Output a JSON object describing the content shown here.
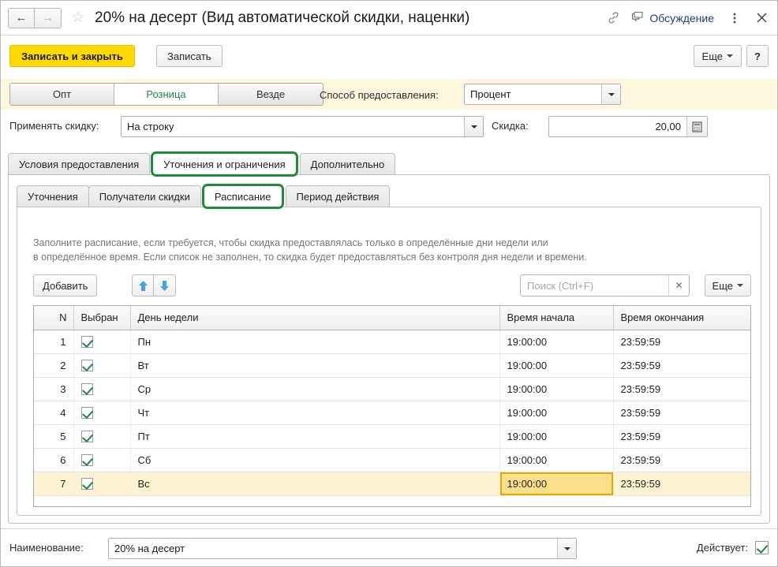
{
  "titlebar": {
    "back_icon": "arrow-left-icon",
    "forward_icon": "arrow-right-icon",
    "favorite_icon": "star-icon",
    "title": "20% на десерт (Вид автоматической скидки, наценки)",
    "link_icon": "link-icon",
    "discuss_icon": "chat-bubble-icon",
    "discuss_label": "Обсуждение",
    "menu_icon": "kebab-menu-icon",
    "close_icon": "close-icon"
  },
  "commandbar": {
    "save_and_close": "Записать и закрыть",
    "save": "Записать",
    "more": "Еще",
    "help": "?"
  },
  "segmented": {
    "items": [
      {
        "label": "Опт",
        "active": false
      },
      {
        "label": "Розница",
        "active": true
      },
      {
        "label": "Везде",
        "active": false
      }
    ]
  },
  "fields": {
    "sposob_label": "Способ предоставления:",
    "sposob_value": "Процент",
    "primenyat_label": "Применять скидку:",
    "primenyat_value": "На строку",
    "skidka_label": "Скидка:",
    "skidka_value": "20,00",
    "calc_icon": "calculator-icon"
  },
  "outer_tabs": [
    {
      "label": "Условия предоставления",
      "active": false,
      "marked": false
    },
    {
      "label": "Уточнения и ограничения",
      "active": true,
      "marked": true
    },
    {
      "label": "Дополнительно",
      "active": false,
      "marked": false
    }
  ],
  "inner_tabs": [
    {
      "label": "Уточнения",
      "active": false,
      "marked": false
    },
    {
      "label": "Получатели скидки",
      "active": false,
      "marked": false
    },
    {
      "label": "Расписание",
      "active": true,
      "marked": true
    },
    {
      "label": "Период действия",
      "active": false,
      "marked": false
    }
  ],
  "hint": {
    "line1": "Заполните расписание, если требуется, чтобы скидка предоставлялась только в определённые дни недели или",
    "line2": "в определённое время. Если список не заполнен, то скидка будет предоставляться без контроля дня недели и времени."
  },
  "list_toolbar": {
    "add": "Добавить",
    "move_up_icon": "arrow-up-icon",
    "move_down_icon": "arrow-down-icon",
    "search_placeholder": "Поиск (Ctrl+F)",
    "search_value": "",
    "clear_icon": "clear-x-icon",
    "more": "Еще"
  },
  "table": {
    "columns": [
      "N",
      "Выбран",
      "День недели",
      "Время начала",
      "Время окончания"
    ],
    "rows": [
      {
        "n": "1",
        "checked": true,
        "day": "Пн",
        "start": "19:00:00",
        "end": "23:59:59"
      },
      {
        "n": "2",
        "checked": true,
        "day": "Вт",
        "start": "19:00:00",
        "end": "23:59:59"
      },
      {
        "n": "3",
        "checked": true,
        "day": "Ср",
        "start": "19:00:00",
        "end": "23:59:59"
      },
      {
        "n": "4",
        "checked": true,
        "day": "Чт",
        "start": "19:00:00",
        "end": "23:59:59"
      },
      {
        "n": "5",
        "checked": true,
        "day": "Пт",
        "start": "19:00:00",
        "end": "23:59:59"
      },
      {
        "n": "6",
        "checked": true,
        "day": "Сб",
        "start": "19:00:00",
        "end": "23:59:59"
      },
      {
        "n": "7",
        "checked": true,
        "day": "Вс",
        "start": "19:00:00",
        "end": "23:59:59"
      }
    ],
    "selected_row_index": 6,
    "selected_cell": "start"
  },
  "bottombar": {
    "naimenovanie_label": "Наименование:",
    "naimenovanie_value": "20% на десерт",
    "deystvuet_label": "Действует:",
    "deystvuet_checked": true
  },
  "colors": {
    "accent_yellow": "#ffd900",
    "band_yellow": "#fdf7dd",
    "marker_green": "#1e8a3c",
    "active_tab_text_green": "#1e8a4c",
    "selected_row": "#fdf3d2",
    "selected_cell": "#fbdf8a",
    "discuss_blue": "#1c3f72"
  }
}
